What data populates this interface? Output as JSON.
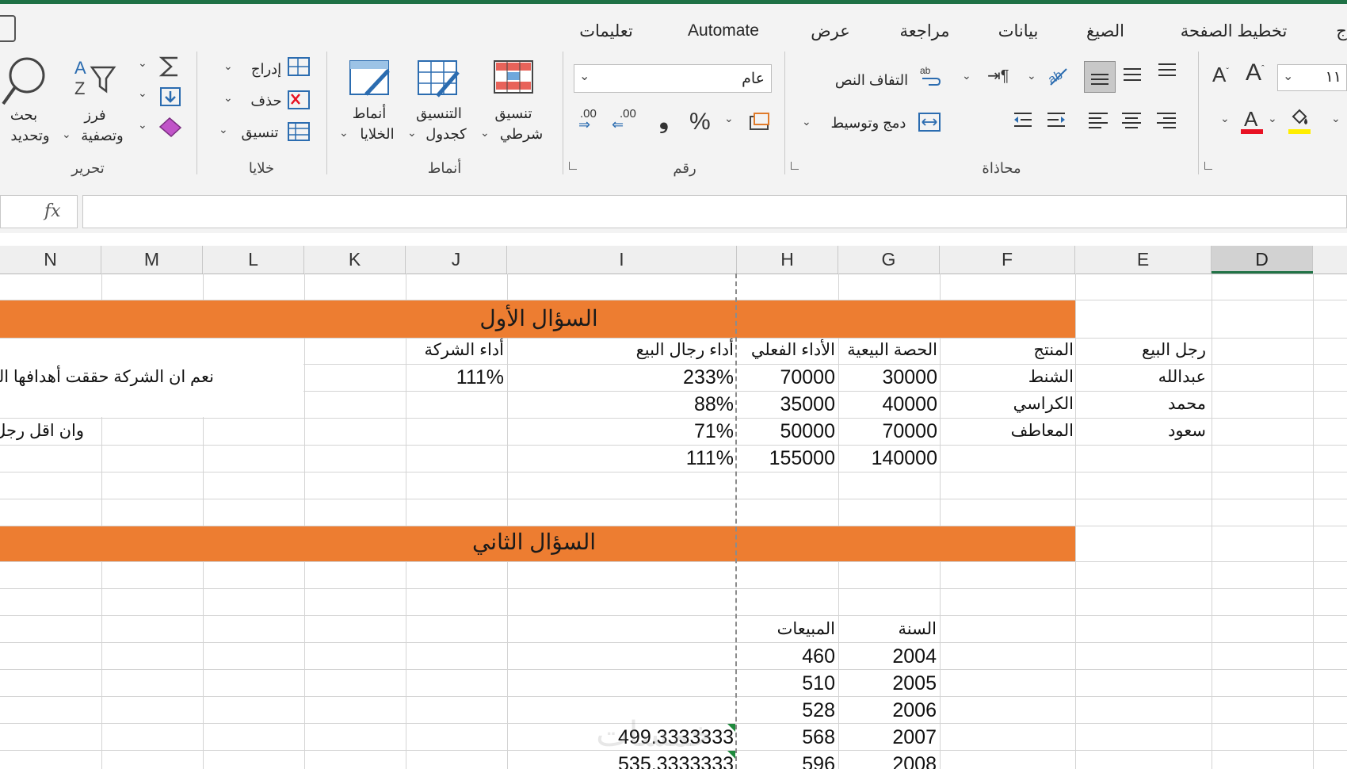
{
  "ribbon_tabs": [
    "تعليمات",
    "Automate",
    "عرض",
    "مراجعة",
    "بيانات",
    "الصيغ",
    "تخطيط الصفحة",
    "ج"
  ],
  "ribbon": {
    "editing": {
      "group": "تحرير",
      "find_l1": "بحث",
      "find_l2": "وتحديد",
      "sort_l1": "فرز",
      "sort_l2": "وتصفية"
    },
    "cells": {
      "group": "خلايا",
      "insert": "إدراج",
      "delete": "حذف",
      "format": "تنسيق"
    },
    "styles": {
      "group": "أنماط",
      "cell_l1": "أنماط",
      "cell_l2": "الخلايا",
      "table_l1": "التنسيق",
      "table_l2": "كجدول",
      "cond_l1": "تنسيق",
      "cond_l2": "شرطي"
    },
    "number": {
      "group": "رقم",
      "format_value": "عام",
      "percent": "%",
      "comma": "❟",
      "inc_dec": ".00",
      "dec_dec": ".00"
    },
    "alignment": {
      "group": "محاذاة",
      "wrap": "التفاف النص",
      "merge": "دمج وتوسيط"
    },
    "font": {
      "size": "١١"
    },
    "colors": {
      "accent": "#217346",
      "font_color_bar": "#e81123",
      "fill_color_bar": "#ffee00",
      "band": "#ed7d31"
    }
  },
  "formula_bar": {
    "fx": "fx",
    "content": ""
  },
  "columns": [
    "N",
    "M",
    "L",
    "K",
    "J",
    "I",
    "H",
    "G",
    "F",
    "E",
    "D"
  ],
  "selected_column": "D",
  "sheet": {
    "q1_title": "السؤال الأول",
    "q2_title": "السؤال الثاني",
    "headers": {
      "salesman": "رجل البيع",
      "product": "المنتج",
      "quota": "الحصة البيعية",
      "actual": "الأداء الفعلي",
      "sales_perf": "أداء رجال البيع",
      "company_perf": "أداء الشركة"
    },
    "rows": [
      {
        "salesman": "عبدالله",
        "product": "الشنط",
        "quota": "30000",
        "actual": "70000",
        "perf": "233%"
      },
      {
        "salesman": "محمد",
        "product": "الكراسي",
        "quota": "40000",
        "actual": "35000",
        "perf": "88%"
      },
      {
        "salesman": "سعود",
        "product": "المعاطف",
        "quota": "70000",
        "actual": "50000",
        "perf": "71%"
      }
    ],
    "totals": {
      "quota": "140000",
      "actual": "155000",
      "perf": "111%"
    },
    "company_perf_value": "111%",
    "note1": "نعم ان الشركة حققت أهدافها البي",
    "note2": "وان اقل رجل",
    "q2_headers": {
      "year": "السنة",
      "sales": "المبيعات"
    },
    "q2_rows": [
      {
        "year": "2004",
        "sales": "460",
        "forecast": ""
      },
      {
        "year": "2005",
        "sales": "510",
        "forecast": ""
      },
      {
        "year": "2006",
        "sales": "528",
        "forecast": ""
      },
      {
        "year": "2007",
        "sales": "568",
        "forecast": "499.3333333"
      },
      {
        "year": "2008",
        "sales": "596",
        "forecast": "535.3333333"
      }
    ],
    "watermark": "خمسات"
  }
}
